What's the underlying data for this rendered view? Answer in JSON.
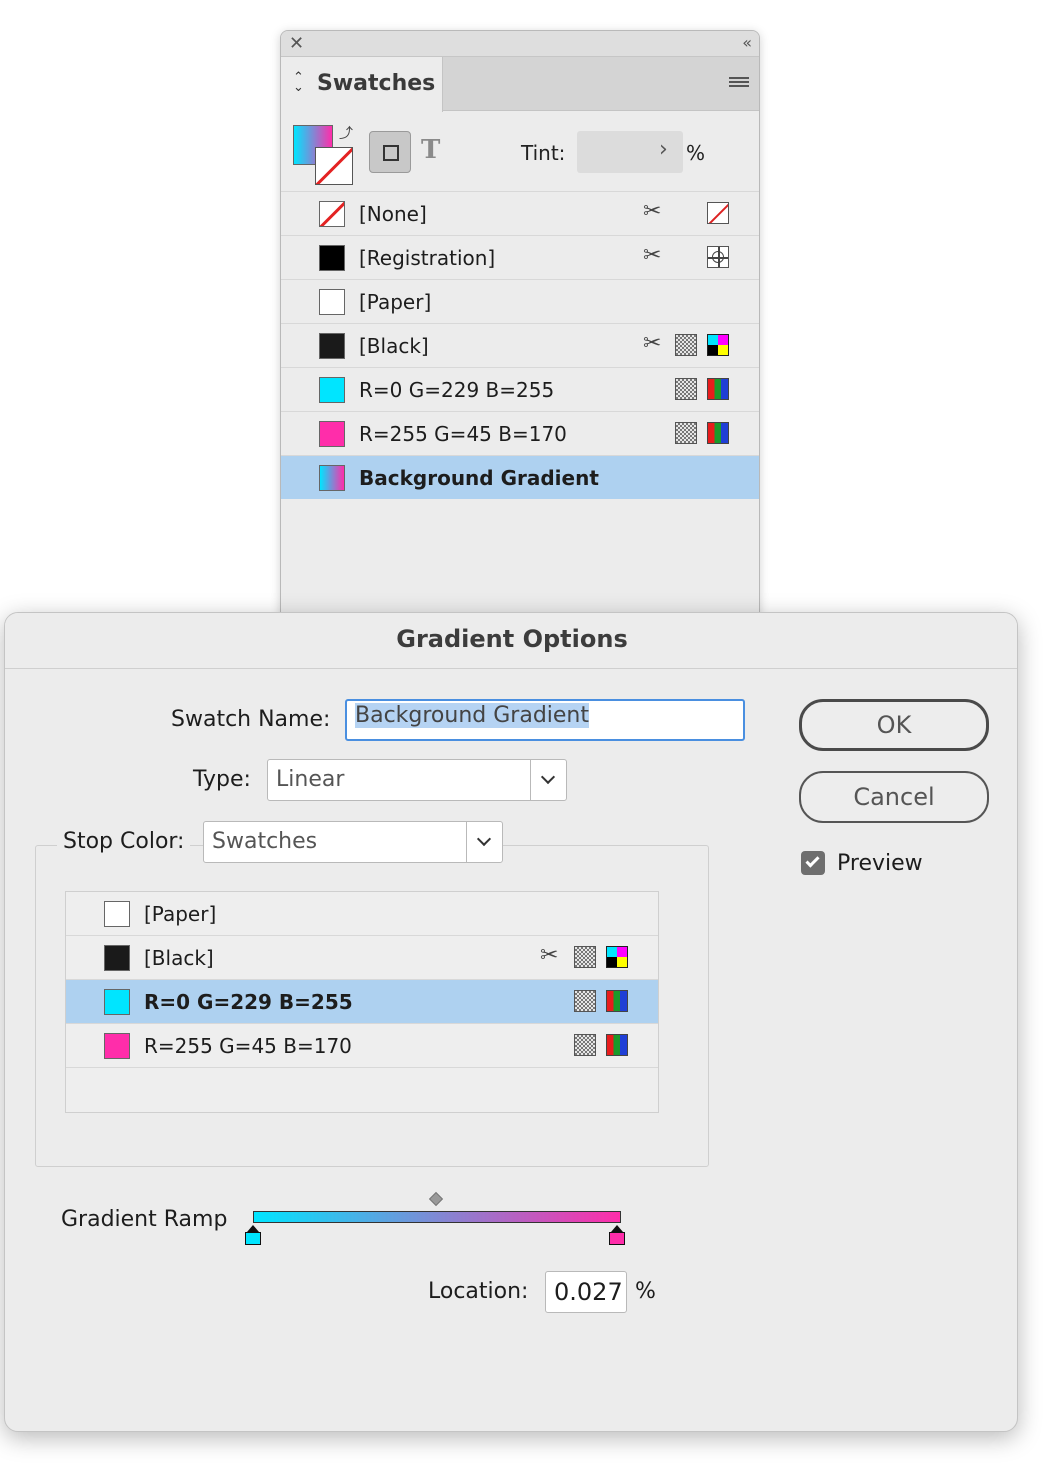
{
  "swatches_panel": {
    "tab_label": "Swatches",
    "tint_label": "Tint:",
    "tint_value": "",
    "tint_unit": "%",
    "rows": [
      {
        "name": "[None]",
        "color": "none",
        "selected": false
      },
      {
        "name": "[Registration]",
        "color": "#000000",
        "selected": false
      },
      {
        "name": "[Paper]",
        "color": "#ffffff",
        "selected": false
      },
      {
        "name": "[Black]",
        "color": "#1a1a1a",
        "selected": false
      },
      {
        "name": "R=0 G=229 B=255",
        "color": "#00e5ff",
        "selected": false
      },
      {
        "name": "R=255 G=45 B=170",
        "color": "#ff2daa",
        "selected": false
      },
      {
        "name": "Background Gradient",
        "color": "gradient",
        "selected": true
      }
    ]
  },
  "dialog": {
    "title": "Gradient Options",
    "swatch_name_label": "Swatch Name:",
    "swatch_name_value": "Background Gradient",
    "type_label": "Type:",
    "type_value": "Linear",
    "stop_color_label": "Stop Color:",
    "stop_color_value": "Swatches",
    "stop_rows": [
      {
        "name": "[Paper]",
        "color": "#ffffff",
        "selected": false
      },
      {
        "name": "[Black]",
        "color": "#1a1a1a",
        "selected": false
      },
      {
        "name": "R=0 G=229 B=255",
        "color": "#00e5ff",
        "selected": true
      },
      {
        "name": "R=255 G=45 B=170",
        "color": "#ff2daa",
        "selected": false
      }
    ],
    "gradient_ramp_label": "Gradient Ramp",
    "gradient_ramp": {
      "start_color": "#00e5ff",
      "end_color": "#ff2daa",
      "midpoint_percent": 50
    },
    "location_label": "Location:",
    "location_value": "0.027",
    "location_unit": "%",
    "ok_label": "OK",
    "cancel_label": "Cancel",
    "preview_label": "Preview",
    "preview_checked": true
  }
}
